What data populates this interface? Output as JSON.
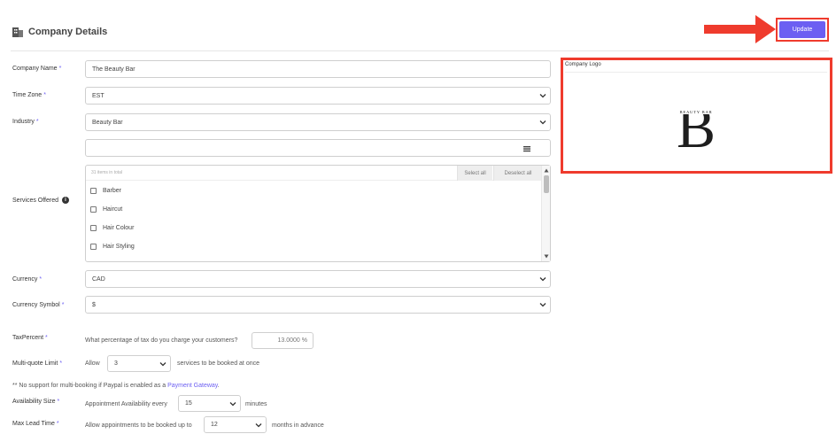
{
  "header": {
    "title": "Company Details",
    "update_label": "Update"
  },
  "form": {
    "company_name": {
      "label": "Company Name",
      "required": "*",
      "value": "The Beauty Bar"
    },
    "time_zone": {
      "label": "Time Zone",
      "required": "*",
      "value": "EST"
    },
    "industry": {
      "label": "Industry",
      "required": "*",
      "value": "Beauty Bar"
    },
    "services": {
      "label": "Services Offered",
      "search_value": "",
      "count_text": "31 items in total",
      "select_all": "Select all",
      "deselect_all": "Deselect all",
      "items": [
        "Barber",
        "Haircut",
        "Hair Colour",
        "Hair Styling"
      ]
    },
    "currency": {
      "label": "Currency",
      "required": "*",
      "value": "CAD"
    },
    "currency_symbol": {
      "label": "Currency Symbol",
      "required": "*",
      "value": "$"
    },
    "tax": {
      "label": "TaxPercent",
      "required": "*",
      "question": "What percentage of tax do you charge your customers?",
      "value": "13.0000 %"
    },
    "multi_quote": {
      "label": "Multi-quote Limit",
      "required": "*",
      "prefix": "Allow",
      "value": "3",
      "suffix": "services to be booked at once"
    },
    "note": {
      "text": "** No support for multi-booking if Paypal is enabled as a",
      "link": "Payment Gateway",
      "end": "."
    },
    "availability": {
      "label": "Availability Size",
      "required": "*",
      "prefix": "Appointment Availability every",
      "value": "15",
      "suffix": "minutes"
    },
    "lead_time": {
      "label": "Max Lead Time",
      "required": "*",
      "prefix": "Allow appointments to be booked up to",
      "value": "12",
      "suffix": "months in advance"
    }
  },
  "logo": {
    "label": "Company Logo",
    "letter": "B",
    "brand_text": "BEAUTY BAR"
  },
  "colors": {
    "accent": "#6c5ff2",
    "highlight": "#ef3b2d"
  },
  "icons": {
    "header": "building-icon",
    "info": "info-icon",
    "dropdown": "chevron-down-icon",
    "list": "list-icon"
  }
}
